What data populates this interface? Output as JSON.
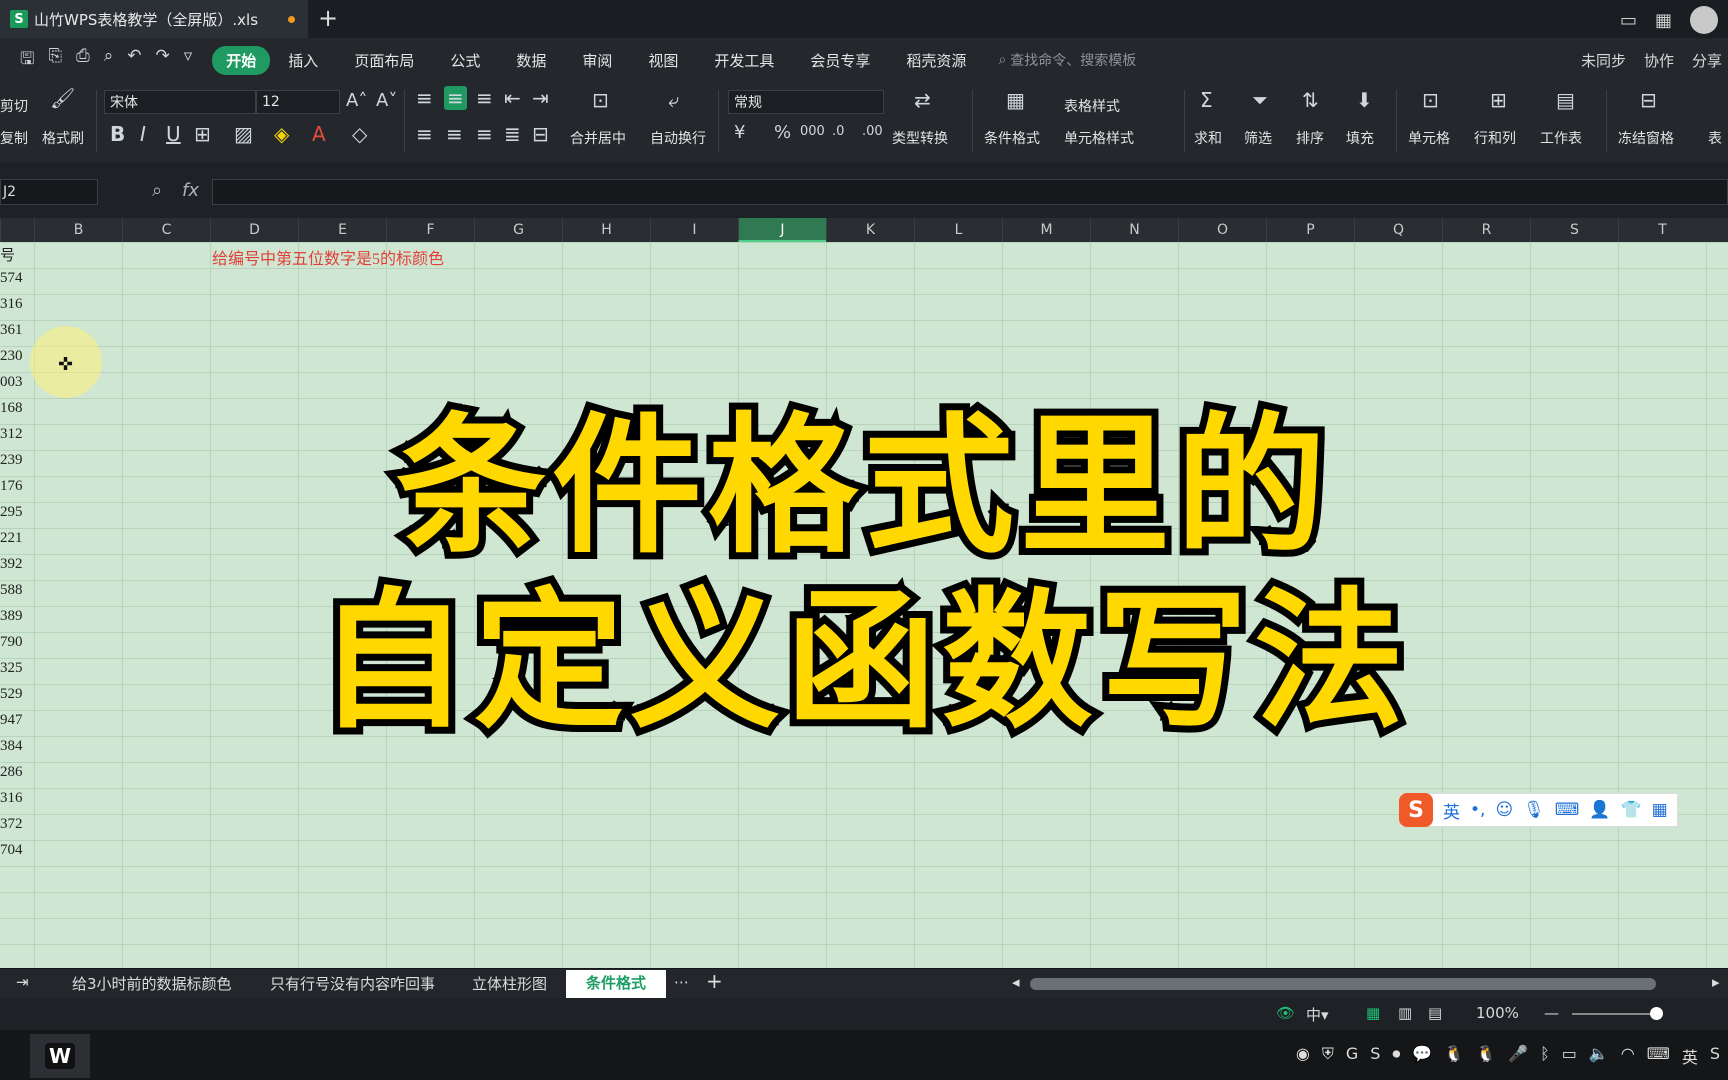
{
  "window": {
    "title": "山竹WPS表格教学（全屏版）.xls"
  },
  "menu": {
    "items": [
      "开始",
      "插入",
      "页面布局",
      "公式",
      "数据",
      "审阅",
      "视图",
      "开发工具",
      "会员专享",
      "稻壳资源"
    ],
    "search_placeholder": "查找命令、搜索模板",
    "right": [
      "未同步",
      "协作",
      "分享"
    ]
  },
  "ribbon": {
    "cut": "剪切",
    "copy": "复制",
    "format_painter": "格式刷",
    "font_name": "宋体",
    "font_size": "12",
    "merge_center": "合并居中",
    "wrap": "自动换行",
    "number_format": "常规",
    "type_convert": "类型转换",
    "cond_format": "条件格式",
    "table_style": "表格样式",
    "cell_style": "单元格样式",
    "sum": "求和",
    "filter": "筛选",
    "sort": "排序",
    "fill": "填充",
    "cell": "单元格",
    "rowcol": "行和列",
    "sheet": "工作表",
    "freeze": "冻结窗格",
    "table_tools": "表"
  },
  "formula": {
    "name_box": "J2",
    "fx": "fx"
  },
  "columns": [
    "B",
    "C",
    "D",
    "E",
    "F",
    "G",
    "H",
    "I",
    "J",
    "K",
    "L",
    "M",
    "N",
    "O",
    "P",
    "Q",
    "R",
    "S",
    "T"
  ],
  "selected_column": "J",
  "row_values": [
    "号",
    "574",
    "316",
    "361",
    "230",
    "003",
    "168",
    "312",
    "239",
    "176",
    "295",
    "221",
    "392",
    "588",
    "389",
    "790",
    "325",
    "529",
    "947",
    "384",
    "286",
    "316",
    "372",
    "704"
  ],
  "note_text": "给编号中第五位数字是5的标颜色",
  "overlay": {
    "line1": "条件格式里的",
    "line2": "自定义函数写法"
  },
  "ime": {
    "logo": "S",
    "mode": "英"
  },
  "sheet_tabs": [
    "给3小时前的数据标颜色",
    "只有行号没有内容咋回事",
    "立体柱形图",
    "条件格式"
  ],
  "active_sheet": "条件格式",
  "status": {
    "zoom": "100%"
  },
  "tray": {
    "lang": "英"
  }
}
